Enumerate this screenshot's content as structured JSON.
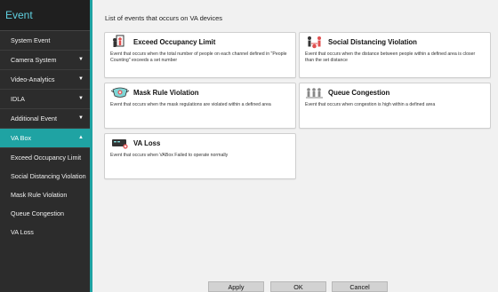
{
  "sidebar": {
    "title": "Event",
    "items": [
      {
        "label": "System Event",
        "chevron": false
      },
      {
        "label": "Camera System",
        "chevron": true
      },
      {
        "label": "Video-Analytics",
        "chevron": true
      },
      {
        "label": "IDLA",
        "chevron": true
      },
      {
        "label": "Additional Event",
        "chevron": true
      },
      {
        "label": "VA Box",
        "chevron": true,
        "active": true
      }
    ],
    "subitems": [
      "Exceed Occupancy Limit",
      "Social Distancing Violation",
      "Mask Rule Violation",
      "Queue Congestion",
      "VA Loss"
    ]
  },
  "main": {
    "heading": "List of events that occurs on VA devices",
    "cards": [
      {
        "title": "Exceed Occupancy Limit",
        "icon": "occupancy-icon",
        "desc": "Event that occurs when the total number of people on each channel defined in \"People Counting\" exceeds a set number"
      },
      {
        "title": "Social Distancing Violation",
        "icon": "social-distancing-icon",
        "desc": "Event that occurs when the distance between people within a defined area is closer than the set distance"
      },
      {
        "title": "Mask Rule Violation",
        "icon": "mask-icon",
        "desc": "Event that occurs when the mask regulations are violated within a defined area"
      },
      {
        "title": "Queue Congestion",
        "icon": "queue-icon",
        "desc": "Event that occurs when congestion is high within a defined area"
      },
      {
        "title": "VA Loss",
        "icon": "va-loss-icon",
        "desc": "Event that occurs when VABox Failed to operate normally"
      }
    ]
  },
  "footer": {
    "apply": "Apply",
    "ok": "OK",
    "cancel": "Cancel"
  },
  "colors": {
    "accent": "#1fa3a3",
    "sidebar_bg": "#2c2c2c",
    "brand_text": "#5fd0e0"
  }
}
